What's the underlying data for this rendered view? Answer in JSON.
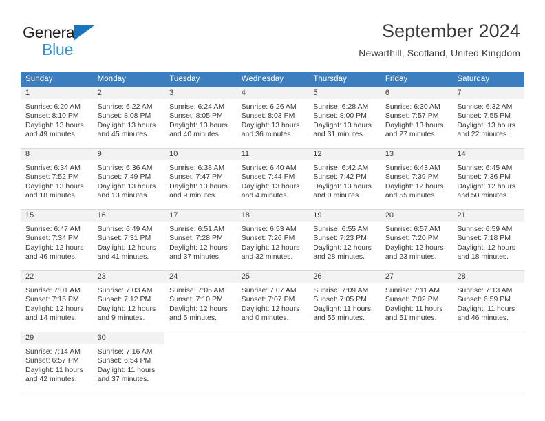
{
  "brand": {
    "name_top": "General",
    "name_bottom": "Blue",
    "accent_color": "#1b75bb",
    "accent_color_light": "#2f93d6",
    "triangle_icon": "triangle-icon"
  },
  "header": {
    "title": "September 2024",
    "subtitle": "Newarthill, Scotland, United Kingdom"
  },
  "calendar": {
    "header_bg": "#3c7fc0",
    "header_text_color": "#ffffff",
    "daynum_band_bg": "#f2f2f2",
    "columns": [
      "Sunday",
      "Monday",
      "Tuesday",
      "Wednesday",
      "Thursday",
      "Friday",
      "Saturday"
    ],
    "weeks": [
      [
        {
          "day": "1",
          "sunrise": "Sunrise: 6:20 AM",
          "sunset": "Sunset: 8:10 PM",
          "daylight_1": "Daylight: 13 hours",
          "daylight_2": "and 49 minutes."
        },
        {
          "day": "2",
          "sunrise": "Sunrise: 6:22 AM",
          "sunset": "Sunset: 8:08 PM",
          "daylight_1": "Daylight: 13 hours",
          "daylight_2": "and 45 minutes."
        },
        {
          "day": "3",
          "sunrise": "Sunrise: 6:24 AM",
          "sunset": "Sunset: 8:05 PM",
          "daylight_1": "Daylight: 13 hours",
          "daylight_2": "and 40 minutes."
        },
        {
          "day": "4",
          "sunrise": "Sunrise: 6:26 AM",
          "sunset": "Sunset: 8:03 PM",
          "daylight_1": "Daylight: 13 hours",
          "daylight_2": "and 36 minutes."
        },
        {
          "day": "5",
          "sunrise": "Sunrise: 6:28 AM",
          "sunset": "Sunset: 8:00 PM",
          "daylight_1": "Daylight: 13 hours",
          "daylight_2": "and 31 minutes."
        },
        {
          "day": "6",
          "sunrise": "Sunrise: 6:30 AM",
          "sunset": "Sunset: 7:57 PM",
          "daylight_1": "Daylight: 13 hours",
          "daylight_2": "and 27 minutes."
        },
        {
          "day": "7",
          "sunrise": "Sunrise: 6:32 AM",
          "sunset": "Sunset: 7:55 PM",
          "daylight_1": "Daylight: 13 hours",
          "daylight_2": "and 22 minutes."
        }
      ],
      [
        {
          "day": "8",
          "sunrise": "Sunrise: 6:34 AM",
          "sunset": "Sunset: 7:52 PM",
          "daylight_1": "Daylight: 13 hours",
          "daylight_2": "and 18 minutes."
        },
        {
          "day": "9",
          "sunrise": "Sunrise: 6:36 AM",
          "sunset": "Sunset: 7:49 PM",
          "daylight_1": "Daylight: 13 hours",
          "daylight_2": "and 13 minutes."
        },
        {
          "day": "10",
          "sunrise": "Sunrise: 6:38 AM",
          "sunset": "Sunset: 7:47 PM",
          "daylight_1": "Daylight: 13 hours",
          "daylight_2": "and 9 minutes."
        },
        {
          "day": "11",
          "sunrise": "Sunrise: 6:40 AM",
          "sunset": "Sunset: 7:44 PM",
          "daylight_1": "Daylight: 13 hours",
          "daylight_2": "and 4 minutes."
        },
        {
          "day": "12",
          "sunrise": "Sunrise: 6:42 AM",
          "sunset": "Sunset: 7:42 PM",
          "daylight_1": "Daylight: 13 hours",
          "daylight_2": "and 0 minutes."
        },
        {
          "day": "13",
          "sunrise": "Sunrise: 6:43 AM",
          "sunset": "Sunset: 7:39 PM",
          "daylight_1": "Daylight: 12 hours",
          "daylight_2": "and 55 minutes."
        },
        {
          "day": "14",
          "sunrise": "Sunrise: 6:45 AM",
          "sunset": "Sunset: 7:36 PM",
          "daylight_1": "Daylight: 12 hours",
          "daylight_2": "and 50 minutes."
        }
      ],
      [
        {
          "day": "15",
          "sunrise": "Sunrise: 6:47 AM",
          "sunset": "Sunset: 7:34 PM",
          "daylight_1": "Daylight: 12 hours",
          "daylight_2": "and 46 minutes."
        },
        {
          "day": "16",
          "sunrise": "Sunrise: 6:49 AM",
          "sunset": "Sunset: 7:31 PM",
          "daylight_1": "Daylight: 12 hours",
          "daylight_2": "and 41 minutes."
        },
        {
          "day": "17",
          "sunrise": "Sunrise: 6:51 AM",
          "sunset": "Sunset: 7:28 PM",
          "daylight_1": "Daylight: 12 hours",
          "daylight_2": "and 37 minutes."
        },
        {
          "day": "18",
          "sunrise": "Sunrise: 6:53 AM",
          "sunset": "Sunset: 7:26 PM",
          "daylight_1": "Daylight: 12 hours",
          "daylight_2": "and 32 minutes."
        },
        {
          "day": "19",
          "sunrise": "Sunrise: 6:55 AM",
          "sunset": "Sunset: 7:23 PM",
          "daylight_1": "Daylight: 12 hours",
          "daylight_2": "and 28 minutes."
        },
        {
          "day": "20",
          "sunrise": "Sunrise: 6:57 AM",
          "sunset": "Sunset: 7:20 PM",
          "daylight_1": "Daylight: 12 hours",
          "daylight_2": "and 23 minutes."
        },
        {
          "day": "21",
          "sunrise": "Sunrise: 6:59 AM",
          "sunset": "Sunset: 7:18 PM",
          "daylight_1": "Daylight: 12 hours",
          "daylight_2": "and 18 minutes."
        }
      ],
      [
        {
          "day": "22",
          "sunrise": "Sunrise: 7:01 AM",
          "sunset": "Sunset: 7:15 PM",
          "daylight_1": "Daylight: 12 hours",
          "daylight_2": "and 14 minutes."
        },
        {
          "day": "23",
          "sunrise": "Sunrise: 7:03 AM",
          "sunset": "Sunset: 7:12 PM",
          "daylight_1": "Daylight: 12 hours",
          "daylight_2": "and 9 minutes."
        },
        {
          "day": "24",
          "sunrise": "Sunrise: 7:05 AM",
          "sunset": "Sunset: 7:10 PM",
          "daylight_1": "Daylight: 12 hours",
          "daylight_2": "and 5 minutes."
        },
        {
          "day": "25",
          "sunrise": "Sunrise: 7:07 AM",
          "sunset": "Sunset: 7:07 PM",
          "daylight_1": "Daylight: 12 hours",
          "daylight_2": "and 0 minutes."
        },
        {
          "day": "26",
          "sunrise": "Sunrise: 7:09 AM",
          "sunset": "Sunset: 7:05 PM",
          "daylight_1": "Daylight: 11 hours",
          "daylight_2": "and 55 minutes."
        },
        {
          "day": "27",
          "sunrise": "Sunrise: 7:11 AM",
          "sunset": "Sunset: 7:02 PM",
          "daylight_1": "Daylight: 11 hours",
          "daylight_2": "and 51 minutes."
        },
        {
          "day": "28",
          "sunrise": "Sunrise: 7:13 AM",
          "sunset": "Sunset: 6:59 PM",
          "daylight_1": "Daylight: 11 hours",
          "daylight_2": "and 46 minutes."
        }
      ],
      [
        {
          "day": "29",
          "sunrise": "Sunrise: 7:14 AM",
          "sunset": "Sunset: 6:57 PM",
          "daylight_1": "Daylight: 11 hours",
          "daylight_2": "and 42 minutes."
        },
        {
          "day": "30",
          "sunrise": "Sunrise: 7:16 AM",
          "sunset": "Sunset: 6:54 PM",
          "daylight_1": "Daylight: 11 hours",
          "daylight_2": "and 37 minutes."
        },
        {
          "day": "",
          "sunrise": "",
          "sunset": "",
          "daylight_1": "",
          "daylight_2": ""
        },
        {
          "day": "",
          "sunrise": "",
          "sunset": "",
          "daylight_1": "",
          "daylight_2": ""
        },
        {
          "day": "",
          "sunrise": "",
          "sunset": "",
          "daylight_1": "",
          "daylight_2": ""
        },
        {
          "day": "",
          "sunrise": "",
          "sunset": "",
          "daylight_1": "",
          "daylight_2": ""
        },
        {
          "day": "",
          "sunrise": "",
          "sunset": "",
          "daylight_1": "",
          "daylight_2": ""
        }
      ]
    ]
  }
}
